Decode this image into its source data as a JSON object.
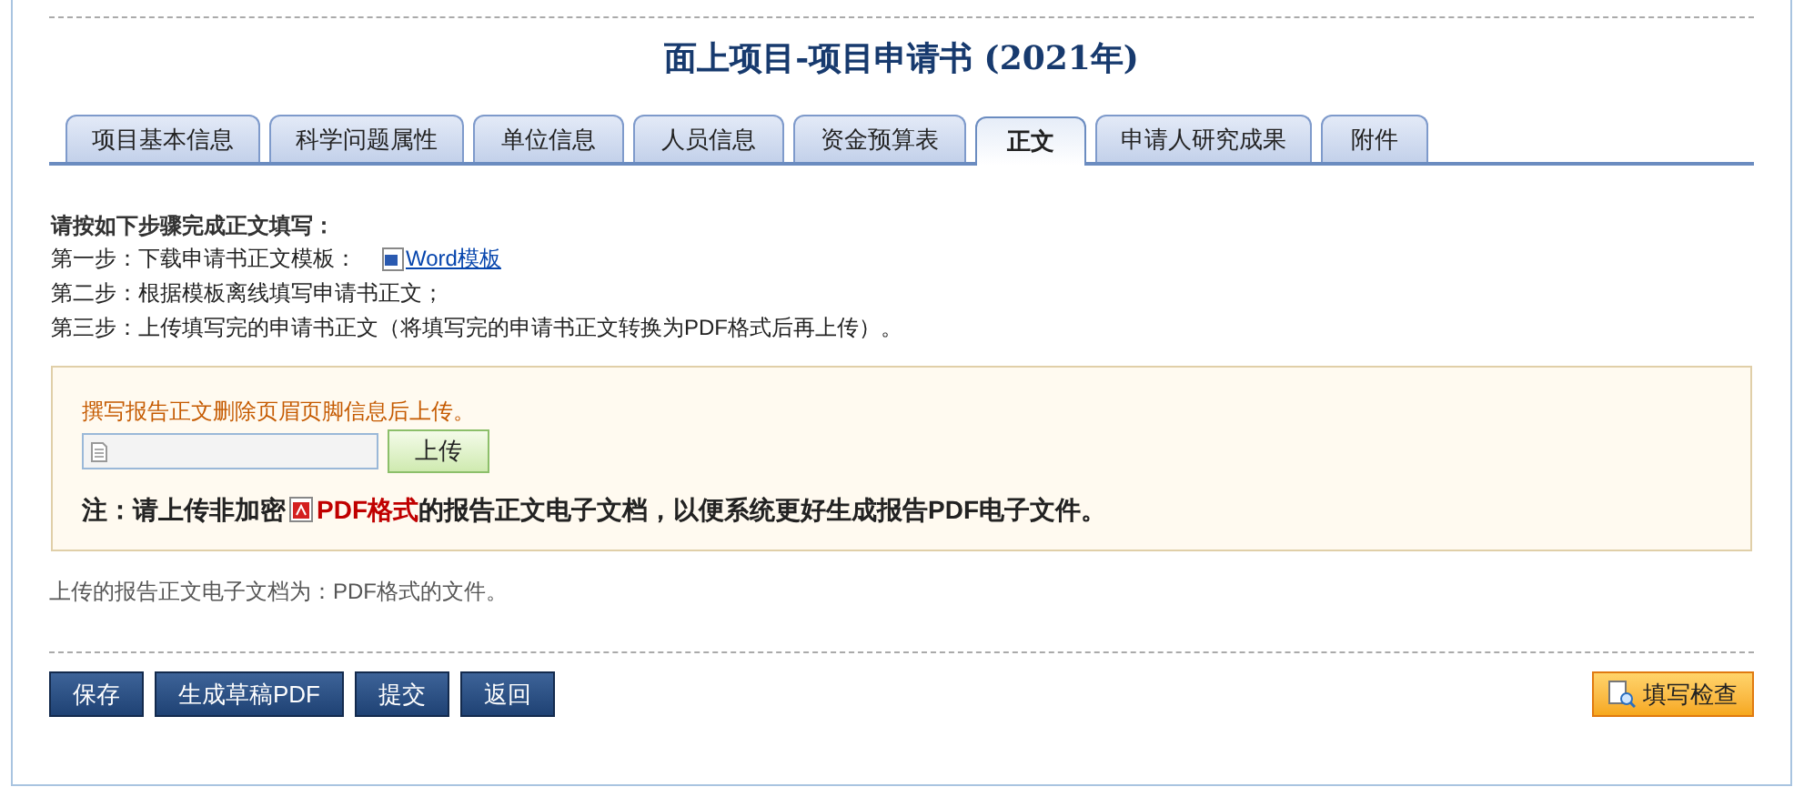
{
  "title": "面上项目-项目申请书 (2021年)",
  "tabs": [
    {
      "label": "项目基本信息",
      "selected": false
    },
    {
      "label": "科学问题属性",
      "selected": false
    },
    {
      "label": "单位信息",
      "selected": false
    },
    {
      "label": "人员信息",
      "selected": false
    },
    {
      "label": "资金预算表",
      "selected": false
    },
    {
      "label": "正文",
      "selected": true
    },
    {
      "label": "申请人研究成果",
      "selected": false
    },
    {
      "label": "附件",
      "selected": false
    }
  ],
  "instructions": {
    "heading": "请按如下步骤完成正文填写：",
    "steps": [
      {
        "label": "第一步：下载申请书正文模板：",
        "link": "Word模板"
      },
      {
        "label": "第二步：根据模板离线填写申请书正文；"
      },
      {
        "label": "第三步：上传填写完的申请书正文（将填写完的申请书正文转换为PDF格式后再上传）。"
      }
    ]
  },
  "upload": {
    "hint": "撰写报告正文删除页眉页脚信息后上传。",
    "button": "上传",
    "note": {
      "prefix": "注：请上传非加密",
      "highlight": "PDF格式",
      "suffix": "的报告正文电子文档，以便系统更好生成报告PDF电子文件。"
    }
  },
  "file_type_note": "上传的报告正文电子文档为：PDF格式的文件。",
  "buttons": [
    {
      "label": "保存",
      "kind": "primary"
    },
    {
      "label": "生成草稿PDF",
      "kind": "primary"
    },
    {
      "label": "提交",
      "kind": "primary"
    },
    {
      "label": "返回",
      "kind": "primary"
    },
    {
      "label": "填写检查",
      "kind": "check"
    }
  ]
}
